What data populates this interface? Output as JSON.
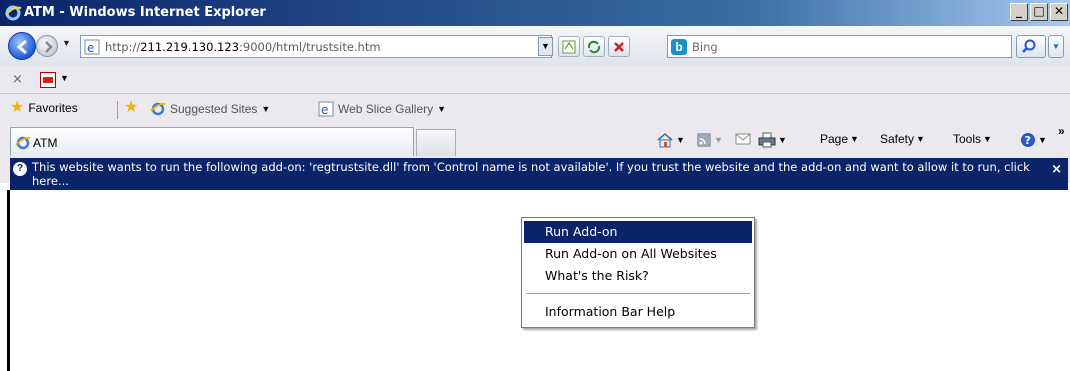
{
  "window": {
    "title": "ATM - Windows Internet Explorer",
    "minimize_glyph": "_",
    "maximize_glyph": "□",
    "close_glyph": "✕"
  },
  "address": {
    "url_prefix": "http://",
    "url_host": "211.219.130.123",
    "url_rest": ":9000/html/trustsite.htm"
  },
  "search": {
    "placeholder": "Bing",
    "engine_icon": "b"
  },
  "favorites_bar": {
    "favorites_label": "Favorites",
    "suggested_sites_label": "Suggested Sites",
    "web_slice_label": "Web Slice Gallery"
  },
  "tabs": [
    {
      "label": "ATM"
    }
  ],
  "command_bar": {
    "page_label": "Page",
    "safety_label": "Safety",
    "tools_label": "Tools",
    "overflow_glyph": "»"
  },
  "info_bar": {
    "message": "This website wants to run the following add-on: 'regtrustsite.dll' from 'Control name is not available'. If you trust the website and the add-on and want to allow it to run, click here...",
    "close_glyph": "×"
  },
  "context_menu": {
    "items": [
      {
        "label": "Run Add-on",
        "highlighted": true
      },
      {
        "label": "Run Add-on on All Websites",
        "highlighted": false
      },
      {
        "label": "What's the Risk?",
        "highlighted": false
      },
      {
        "label": "Information Bar Help",
        "highlighted": false
      }
    ]
  },
  "colors": {
    "infobar": "#0a246a",
    "highlight": "#0a246a",
    "titlebar_start": "#0a246a",
    "titlebar_end": "#a6caf0"
  }
}
